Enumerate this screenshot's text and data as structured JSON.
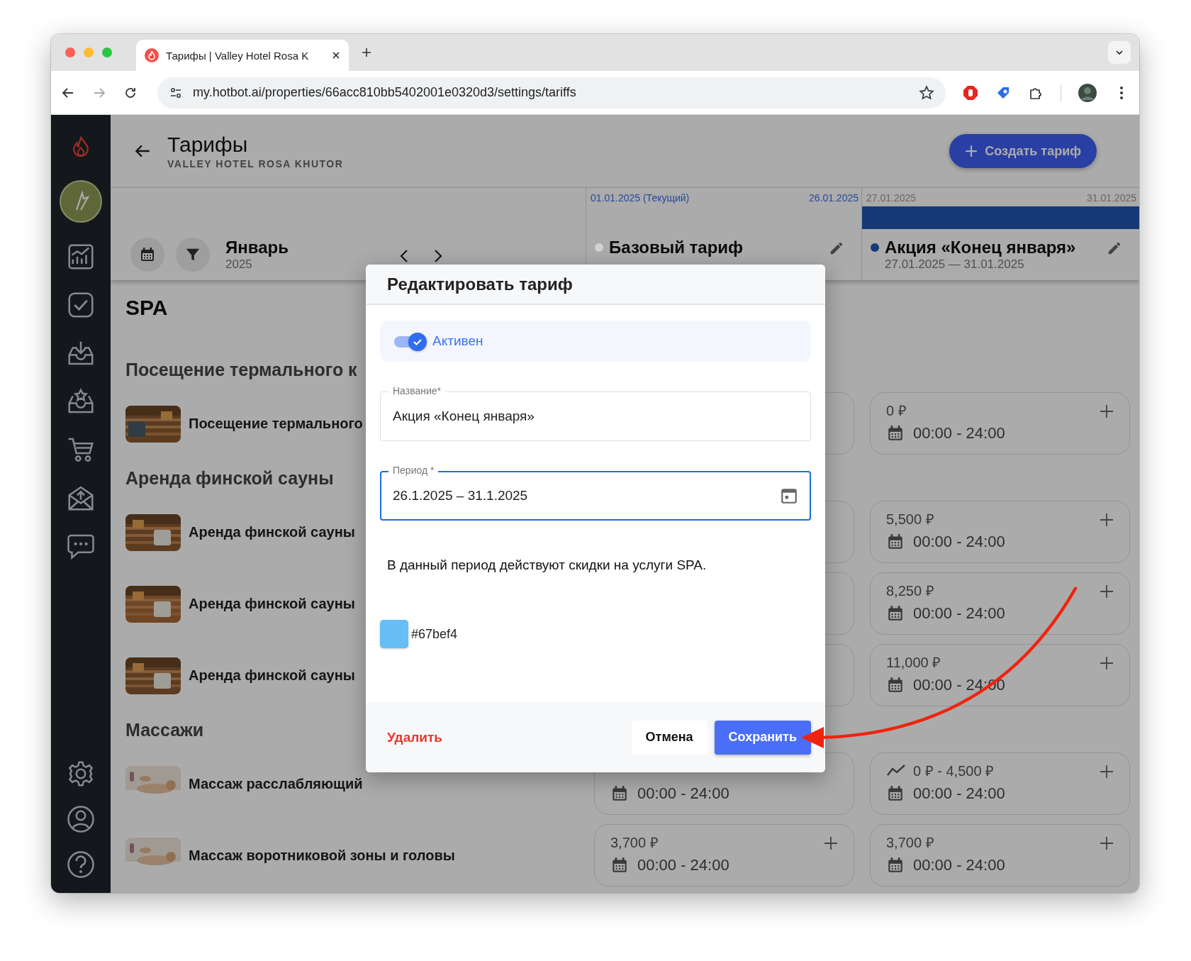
{
  "browser": {
    "tab_title": "Тарифы | Valley Hotel Rosa K",
    "url": "my.hotbot.ai/properties/66acc810bb5402001e0320d3/settings/tariffs"
  },
  "header": {
    "title": "Тарифы",
    "subtitle": "VALLEY HOTEL ROSA KHUTOR",
    "create_button": "Создать тариф"
  },
  "toolbar": {
    "month": "Январь",
    "year": "2025"
  },
  "tariffs": [
    {
      "start": "01.01.2025 (Текущий)",
      "end": "26.01.2025",
      "current": true,
      "bar": false,
      "name": "Базовый тариф",
      "color": "#d2d2d2"
    },
    {
      "start": "27.01.2025",
      "end": "31.01.2025",
      "current": false,
      "bar": true,
      "name": "Акция «Конец января»",
      "dates": "27.01.2025 — 31.01.2025",
      "color": "#163a78"
    }
  ],
  "section_title": "SPA",
  "groups": [
    {
      "title": "Посещение термального к",
      "items": [
        {
          "name": "Посещение термального",
          "cells": [
            {
              "kind": "empty"
            },
            {
              "kind": "price",
              "price": "0 ₽",
              "time": "00:00 - 24:00"
            }
          ]
        }
      ]
    },
    {
      "title": "Аренда финской сауны",
      "items": [
        {
          "name": "Аренда финской сауны",
          "cells": [
            {
              "kind": "empty"
            },
            {
              "kind": "price",
              "price": "5,500 ₽",
              "time": "00:00 - 24:00"
            }
          ]
        },
        {
          "name": "Аренда финской сауны",
          "cells": [
            {
              "kind": "empty"
            },
            {
              "kind": "price",
              "price": "8,250 ₽",
              "time": "00:00 - 24:00"
            }
          ]
        },
        {
          "name": "Аренда финской сауны",
          "cells": [
            {
              "kind": "empty"
            },
            {
              "kind": "price",
              "price": "11,000 ₽",
              "time": "00:00 - 24:00"
            }
          ]
        }
      ]
    },
    {
      "title": "Массажи",
      "items": [
        {
          "name": "Массаж расслабляющий",
          "cells": [
            {
              "kind": "time",
              "time": "00:00 - 24:00"
            },
            {
              "kind": "range",
              "price": "0 ₽ - 4,500 ₽",
              "time": "00:00 - 24:00"
            }
          ]
        },
        {
          "name": "Массаж воротниковой зоны и головы",
          "cells": [
            {
              "kind": "price",
              "price": "3,700 ₽",
              "time": "00:00 - 24:00"
            },
            {
              "kind": "price",
              "price": "3,700 ₽",
              "time": "00:00 - 24:00"
            }
          ]
        }
      ]
    }
  ],
  "modal": {
    "title": "Редактировать тариф",
    "active": {
      "label": "Активен",
      "on": true
    },
    "fields": [
      {
        "kind": "text",
        "label": "Название*",
        "value": "Акция «Конец января»",
        "focused": false
      },
      {
        "kind": "date",
        "label": "Период *",
        "value": "26.1.2025 – 31.1.2025",
        "focused": true
      }
    ],
    "description": "В данный период действуют скидки на услуги SPA.",
    "swatch": {
      "color": "#67bef4",
      "label": "#67bef4"
    },
    "delete_button": "Удалить",
    "cancel_button": "Отмена",
    "save_button": "Сохранить"
  }
}
